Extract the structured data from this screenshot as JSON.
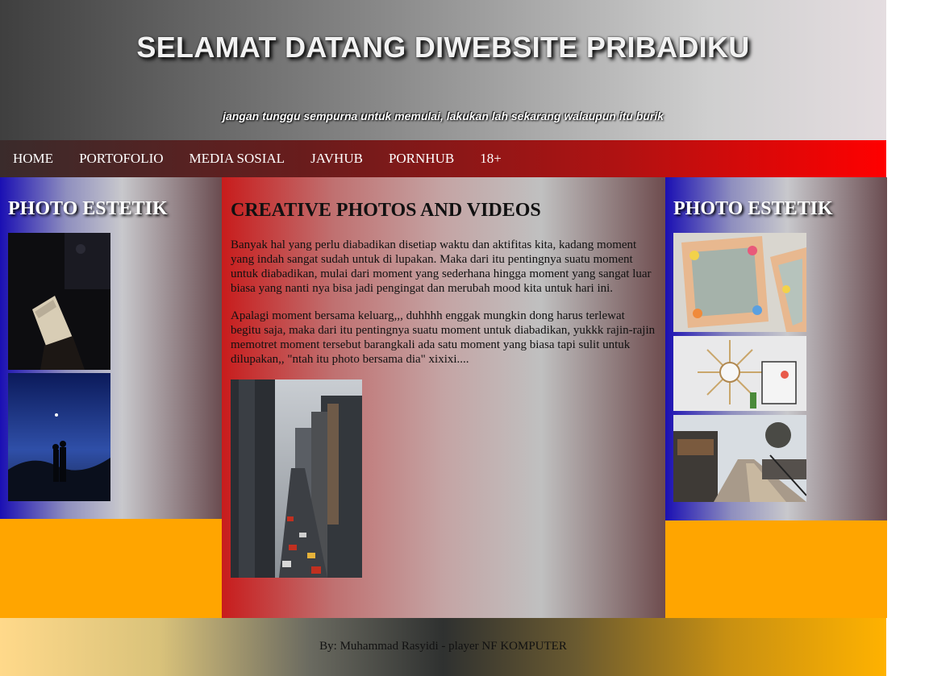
{
  "header": {
    "title": "SELAMAT DATANG DIWEBSITE PRIBADIKU",
    "tagline": "jangan tunggu sempurna untuk memulai, lakukan lah sekarang walaupun itu burik"
  },
  "nav": {
    "items": [
      "HOME",
      "PORTOFOLIO",
      "MEDIA SOSIAL",
      "JAVHUB",
      "PORNHUB",
      "18+"
    ]
  },
  "left_sidebar": {
    "heading": "PHOTO ESTETIK"
  },
  "right_sidebar": {
    "heading": "PHOTO ESTETIK"
  },
  "main": {
    "heading": "CREATIVE PHOTOS AND VIDEOS",
    "paragraphs": [
      "Banyak hal yang perlu diabadikan disetiap waktu dan aktifitas kita, kadang moment yang indah sangat sudah untuk di lupakan. Maka dari itu pentingnya suatu moment untuk diabadikan, mulai dari moment yang sederhana hingga moment yang sangat luar biasa yang nanti nya bisa jadi pengingat dan merubah mood kita untuk hari ini.",
      "Apalagi moment bersama keluarg,,, duhhhh enggak mungkin dong harus terlewat begitu saja, maka dari itu pentingnya suatu moment untuk diabadikan, yukkk rajin-rajin memotret moment tersebut barangkali ada satu moment yang biasa tapi sulit untuk dilupakan,, \"ntah itu photo bersama dia\" xixixi...."
    ]
  },
  "footer": {
    "credit": "By: Muhammad Rasyidi - player NF KOMPUTER"
  },
  "colors": {
    "nav_end": "#ff0000",
    "filler": "#ffa500",
    "sidebar_start": "#1a0fb3"
  }
}
